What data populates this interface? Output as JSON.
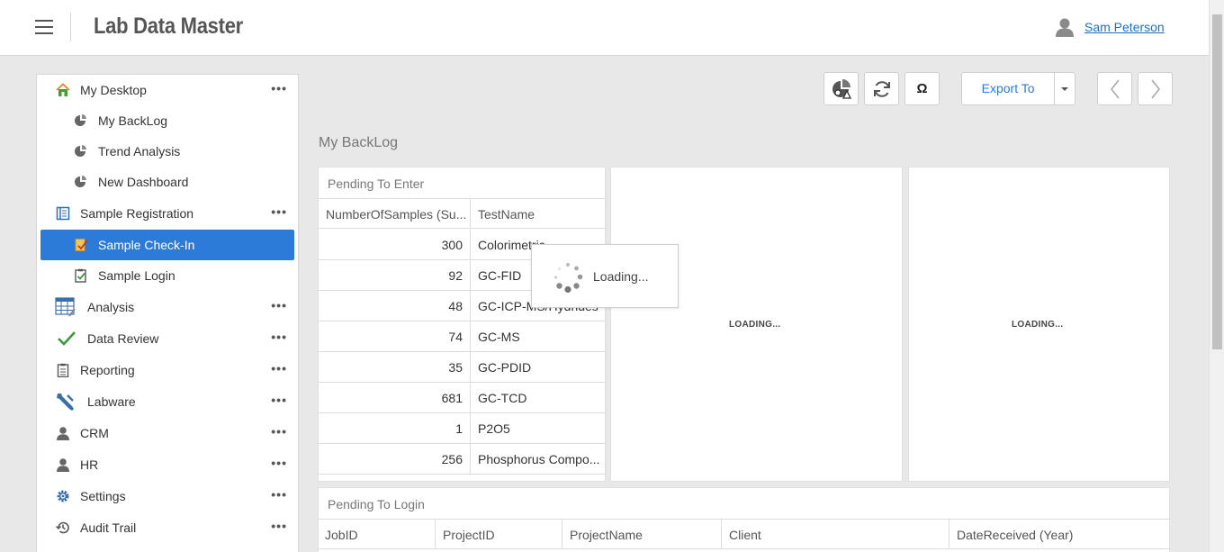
{
  "header": {
    "app_title": "Lab Data Master",
    "user_name": "Sam Peterson",
    "menu_icon": "hamburger-icon",
    "user_icon": "user-icon"
  },
  "sidebar": {
    "items": [
      {
        "label": "My Desktop",
        "icon": "home-icon",
        "more": "•••"
      },
      {
        "label": "My BackLog",
        "icon": "pie-chart-icon"
      },
      {
        "label": "Trend Analysis",
        "icon": "pie-chart-icon"
      },
      {
        "label": "New Dashboard",
        "icon": "pie-chart-icon"
      },
      {
        "label": "Sample Registration",
        "icon": "registration-book-icon",
        "more": "•••"
      },
      {
        "label": "Sample Check-In",
        "icon": "check-in-icon"
      },
      {
        "label": "Sample Login",
        "icon": "clipboard-check-icon"
      },
      {
        "label": "Analysis",
        "icon": "spreadsheet-icon",
        "more": "•••"
      },
      {
        "label": "Data Review",
        "icon": "checkmark-icon",
        "more": "•••"
      },
      {
        "label": "Reporting",
        "icon": "clipboard-icon",
        "more": "•••"
      },
      {
        "label": "Labware",
        "icon": "wrench-icon",
        "more": "•••"
      },
      {
        "label": "CRM",
        "icon": "person-icon",
        "more": "•••"
      },
      {
        "label": "HR",
        "icon": "person-icon",
        "more": "•••"
      },
      {
        "label": "Settings",
        "icon": "gear-icon",
        "more": "•••"
      },
      {
        "label": "Audit Trail",
        "icon": "history-icon",
        "more": "•••"
      }
    ],
    "active": "Sample Check-In"
  },
  "toolbar": {
    "export_label": "Export To",
    "chart_icon": "chart-settings-icon",
    "refresh_icon": "refresh-icon",
    "omega_label": "Ω"
  },
  "main": {
    "section_title": "My BackLog",
    "pending_enter": {
      "title": "Pending To Enter",
      "columns": [
        "NumberOfSamples (Su...",
        "TestName"
      ],
      "rows": [
        {
          "num": "300",
          "name": "Colorimetric"
        },
        {
          "num": "92",
          "name": "GC-FID"
        },
        {
          "num": "48",
          "name": "GC-ICP-MS/Hydrides"
        },
        {
          "num": "74",
          "name": "GC-MS"
        },
        {
          "num": "35",
          "name": "GC-PDID"
        },
        {
          "num": "681",
          "name": "GC-TCD"
        },
        {
          "num": "1",
          "name": "P2O5"
        },
        {
          "num": "256",
          "name": "Phosphorus Compo..."
        }
      ]
    },
    "loading_popup": "Loading...",
    "chart1_loading": "LOADING...",
    "chart2_loading": "LOADING...",
    "pending_login": {
      "title": "Pending To Login",
      "columns": [
        "JobID",
        "ProjectID",
        "ProjectName",
        "Client",
        "DateReceived (Year)"
      ]
    }
  },
  "colors": {
    "accent": "#2d7bd8",
    "link": "#1f6fbf",
    "background": "#e8e8e8"
  }
}
